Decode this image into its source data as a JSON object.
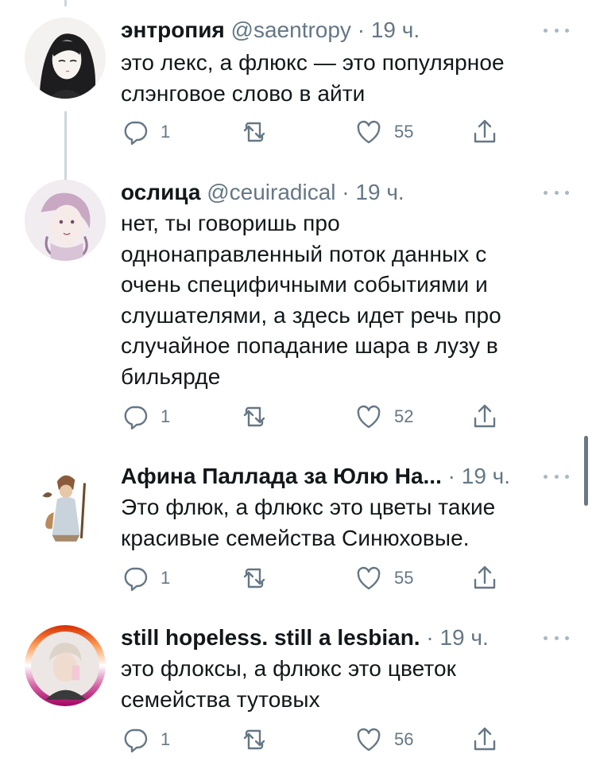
{
  "tweets": [
    {
      "name": "энтропия",
      "handle": "@saentropy",
      "time": "19 ч.",
      "text_lines": [
        "это лекс, а флюкс — это популярное",
        "слэнговое слово в айти"
      ],
      "replies": "1",
      "retweets": "",
      "likes": "55",
      "avatar": "anime-dark-hair-avatar"
    },
    {
      "name": "ослица",
      "handle": "@ceuiradical",
      "time": "19 ч.",
      "text_lines": [
        "нет, ты говоришь про",
        "однонаправленный поток данных с",
        "очень специфичными событиями и",
        "слушателями, а здесь идет речь про",
        "случайное попадание шара в лузу в",
        "бильярде"
      ],
      "replies": "1",
      "retweets": "",
      "likes": "52",
      "avatar": "watercolor-face-avatar"
    },
    {
      "name": "Афина Паллада за Юлю На...",
      "handle": "",
      "time": "19 ч.",
      "text_lines": [
        "Это флюк, а флюкс это цветы такие",
        "красивые семейства Синюховые."
      ],
      "replies": "1",
      "retweets": "",
      "likes": "55",
      "avatar": "athena-statue-avatar"
    },
    {
      "name": "still hopeless. still a lesbian.",
      "handle": "",
      "time": "19 ч.",
      "text_lines": [
        "это флоксы, а флюкс это цветок",
        "семейства тутовых"
      ],
      "replies": "1",
      "retweets": "",
      "likes": "56",
      "avatar": "selfie-pride-frame-avatar"
    }
  ],
  "colors": {
    "text": "#14171a",
    "secondary": "#657786",
    "thread_line": "#ccd6dd",
    "icon": "#657786"
  }
}
